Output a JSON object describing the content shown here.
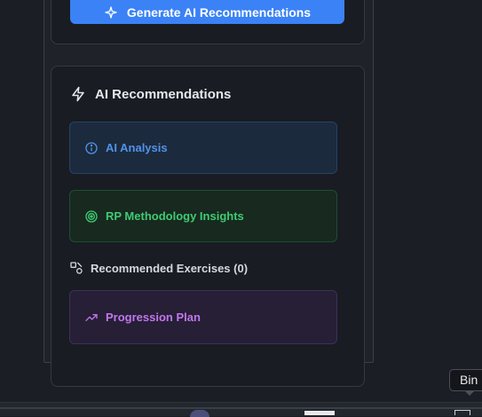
{
  "generate_button": {
    "label": "Generate AI Recommendations",
    "icon": "sparkles-icon"
  },
  "recommendations": {
    "title": "AI Recommendations",
    "title_icon": "lightning-icon",
    "ai_analysis": {
      "label": "AI Analysis",
      "icon": "info-icon"
    },
    "rp_insights": {
      "label": "RP Methodology Insights",
      "icon": "target-icon"
    },
    "exercises_label": "Recommended Exercises (0)",
    "exercises_icon": "shapes-icon",
    "progression": {
      "label": "Progression Plan",
      "icon": "trending-up-icon"
    }
  },
  "tooltip": {
    "text": "Bin"
  },
  "colors": {
    "primary_button": "#3b82f6",
    "ai_analysis": "#4f93ea",
    "rp_insights": "#3ecb72",
    "progression": "#c276ee"
  }
}
